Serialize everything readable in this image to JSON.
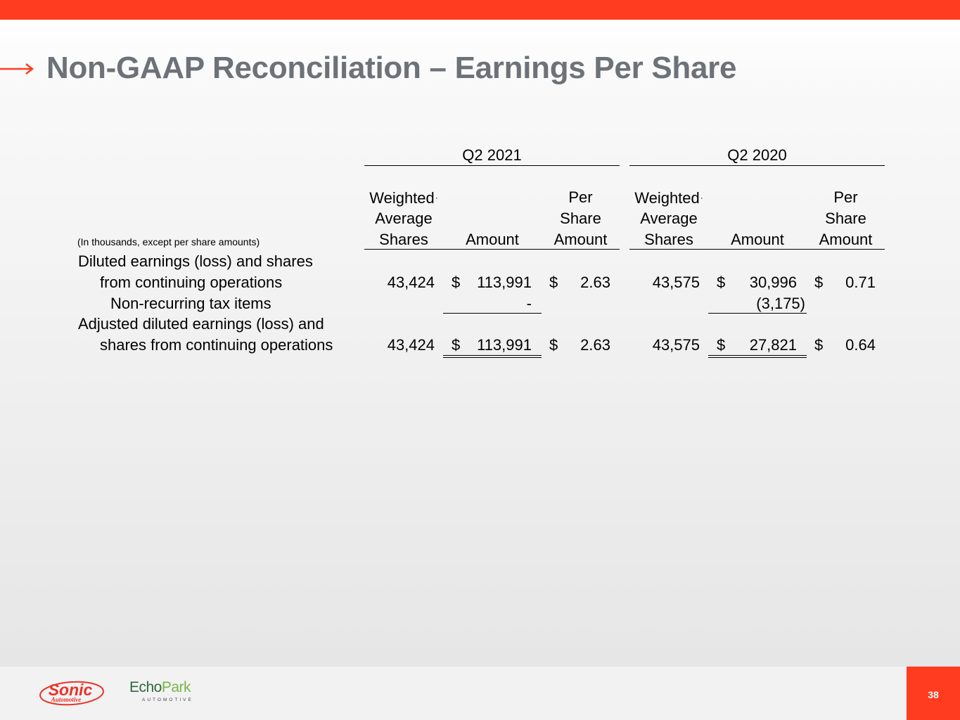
{
  "title": "Non-GAAP Reconciliation – Earnings Per Share",
  "table": {
    "note": "(In thousands, except per share amounts)",
    "periods": [
      "Q2 2021",
      "Q2 2020"
    ],
    "col_headers": {
      "shares": [
        "Weighted",
        "Average",
        "Shares"
      ],
      "amount": "Amount",
      "per_share": [
        "Per",
        "Share",
        "Amount"
      ]
    },
    "rows": [
      {
        "label_lines": [
          "Diluted earnings (loss) and shares",
          "from continuing operations"
        ],
        "q2_2021": {
          "shares": "43,424",
          "currency": "$",
          "amount": "113,991",
          "ps_currency": "$",
          "per_share": "2.63"
        },
        "q2_2020": {
          "shares": "43,575",
          "currency": "$",
          "amount": "30,996",
          "ps_currency": "$",
          "per_share": "0.71"
        }
      },
      {
        "label_lines": [
          "Non-recurring tax items"
        ],
        "q2_2021": {
          "amount": "-"
        },
        "q2_2020": {
          "amount": "(3,175)"
        }
      },
      {
        "label_lines": [
          "Adjusted diluted earnings (loss) and",
          "shares from continuing operations"
        ],
        "q2_2021": {
          "shares": "43,424",
          "currency": "$",
          "amount": "113,991",
          "ps_currency": "$",
          "per_share": "2.63"
        },
        "q2_2020": {
          "shares": "43,575",
          "currency": "$",
          "amount": "27,821",
          "ps_currency": "$",
          "per_share": "0.64"
        }
      }
    ]
  },
  "footer": {
    "sonic_logo": {
      "word": "Sonic",
      "sub": "Automotive"
    },
    "echopark_logo": {
      "word_a": "Echo",
      "word_b": "Park",
      "sub": "AUTOMOTIVE"
    },
    "page_number": "38"
  },
  "colors": {
    "accent": "#ff3c1f",
    "title": "#6d7278",
    "echo_dark": "#2d6a3e",
    "echo_light": "#7ab648"
  }
}
